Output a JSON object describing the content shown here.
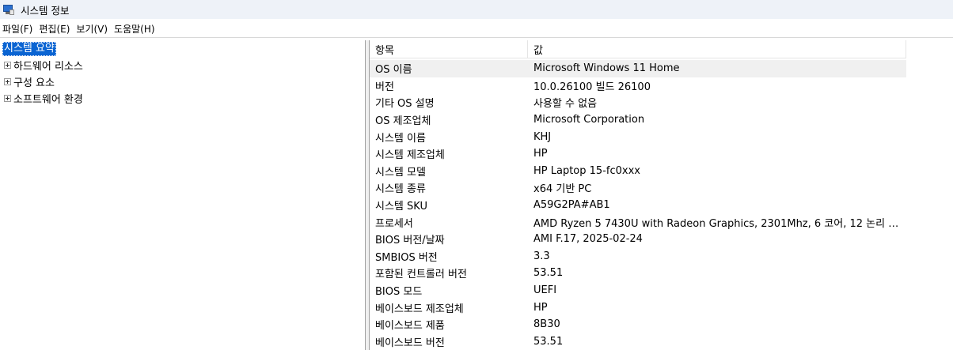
{
  "window": {
    "title": "시스템 정보",
    "icon": "system-information-icon"
  },
  "menu": [
    {
      "label": "파일(F)"
    },
    {
      "label": "편집(E)"
    },
    {
      "label": "보기(V)"
    },
    {
      "label": "도움말(H)"
    }
  ],
  "tree": {
    "root": "시스템 요약",
    "children": [
      {
        "label": "하드웨어 리소스",
        "expander": "plus-expander-icon"
      },
      {
        "label": "구성 요소",
        "expander": "plus-expander-icon"
      },
      {
        "label": "소프트웨어 환경",
        "expander": "plus-expander-icon"
      }
    ]
  },
  "list": {
    "headers": {
      "item": "항목",
      "value": "값"
    },
    "selected_index": 0,
    "rows": [
      {
        "item": "OS 이름",
        "value": "Microsoft Windows 11 Home"
      },
      {
        "item": "버전",
        "value": "10.0.26100 빌드 26100"
      },
      {
        "item": "기타 OS 설명",
        "value": "사용할 수 없음"
      },
      {
        "item": "OS 제조업체",
        "value": "Microsoft Corporation"
      },
      {
        "item": "시스템 이름",
        "value": "KHJ"
      },
      {
        "item": "시스템 제조업체",
        "value": "HP"
      },
      {
        "item": "시스템 모델",
        "value": "HP Laptop 15-fc0xxx"
      },
      {
        "item": "시스템 종류",
        "value": "x64 기반 PC"
      },
      {
        "item": "시스템 SKU",
        "value": "A59G2PA#AB1"
      },
      {
        "item": "프로세서",
        "value": "AMD Ryzen 5 7430U with Radeon Graphics, 2301Mhz, 6 코어, 12 논리 프로..."
      },
      {
        "item": "BIOS 버전/날짜",
        "value": "AMI F.17, 2025-02-24"
      },
      {
        "item": "SMBIOS 버전",
        "value": "3.3"
      },
      {
        "item": "포함된 컨트롤러 버전",
        "value": "53.51"
      },
      {
        "item": "BIOS 모드",
        "value": "UEFI"
      },
      {
        "item": "베이스보드 제조업체",
        "value": "HP"
      },
      {
        "item": "베이스보드 제품",
        "value": "8B30"
      },
      {
        "item": "베이스보드 버전",
        "value": "53.51"
      }
    ]
  },
  "colors": {
    "titlebar_bg": "#eef2f8",
    "tree_selection": "#0a64d2",
    "row_selection": "#f0f0f0"
  }
}
